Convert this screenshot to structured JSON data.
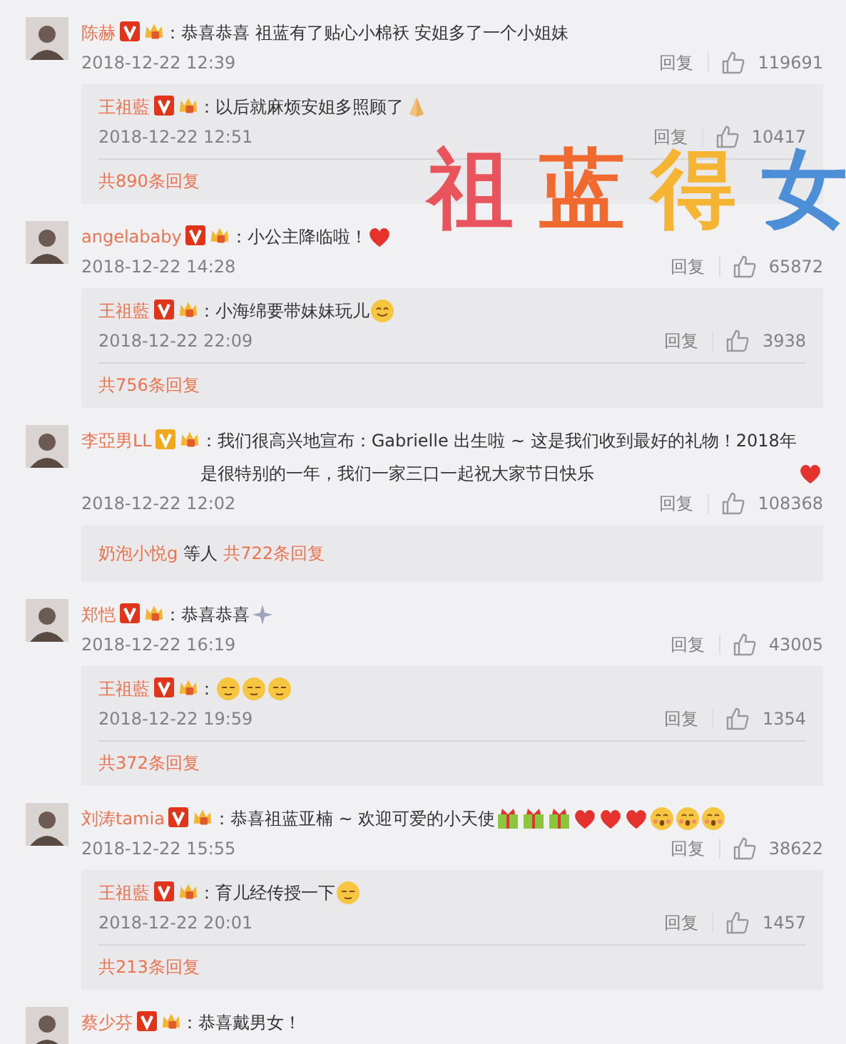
{
  "overlay_title": [
    {
      "text": "祖",
      "color": "#e9545c"
    },
    {
      "text": "蓝",
      "color": "#f06a2f"
    },
    {
      "text": "得",
      "color": "#f6b433"
    },
    {
      "text": "女",
      "color": "#4d8fd6"
    }
  ],
  "comments": [
    {
      "user": "陈赫",
      "verified": {
        "color": "#e0341b"
      },
      "text": "：恭喜恭喜 祖蓝有了贴心小棉袄 安姐多了一个小姐妹",
      "date": "2018-12-22 12:39",
      "reply_label": "回复",
      "likes": "119691",
      "replies": {
        "kind": "thread",
        "user": "王祖藍",
        "verified": {
          "color": "#e0341b"
        },
        "text": "：以后就麻烦安姐多照顾了",
        "emojis": [
          {
            "kind": "hands"
          }
        ],
        "date": "2018-12-22 12:51",
        "reply_label": "回复",
        "likes": "10417",
        "more": "共890条回复"
      }
    },
    {
      "user": "angelababy",
      "verified": {
        "color": "#e0341b"
      },
      "text": "：小公主降临啦！",
      "emojis": [
        {
          "kind": "heart"
        }
      ],
      "date": "2018-12-22 14:28",
      "reply_label": "回复",
      "likes": "65872",
      "replies": {
        "kind": "thread",
        "user": "王祖藍",
        "verified": {
          "color": "#e0341b"
        },
        "text": "：小海绵要带妹妹玩儿",
        "emojis": [
          {
            "kind": "smile"
          }
        ],
        "date": "2018-12-22 22:09",
        "reply_label": "回复",
        "likes": "3938",
        "more": "共756条回复"
      }
    },
    {
      "user": "李亞男LL",
      "verified": {
        "color": "#f0a81c"
      },
      "text": "：我们很高兴地宣布：Gabrielle 出生啦 ~ 这是我们收到最好的礼物！2018年是很特别的一年，我们一家三口一起祝大家节日快乐",
      "emojis": [
        {
          "kind": "heart"
        }
      ],
      "date": "2018-12-22 12:02",
      "reply_label": "回复",
      "likes": "108368",
      "replies": {
        "kind": "summary",
        "user": "奶泡小悦g",
        "mid": "等人",
        "more": "共722条回复"
      }
    },
    {
      "user": "郑恺",
      "verified": {
        "color": "#e0341b"
      },
      "text": "：恭喜恭喜",
      "emojis": [
        {
          "kind": "sparkle"
        }
      ],
      "date": "2018-12-22 16:19",
      "reply_label": "回复",
      "likes": "43005",
      "replies": {
        "kind": "thread",
        "user": "王祖藍",
        "verified": {
          "color": "#e0341b"
        },
        "text": "：",
        "emojis": [
          {
            "kind": "smug"
          },
          {
            "kind": "smug"
          },
          {
            "kind": "smug"
          }
        ],
        "date": "2018-12-22 19:59",
        "reply_label": "回复",
        "likes": "1354",
        "more": "共372条回复"
      }
    },
    {
      "user": "刘涛tamia",
      "verified": {
        "color": "#e0341b"
      },
      "text": "：恭喜祖蓝亚楠 ~ 欢迎可爱的小天使",
      "emojis": [
        {
          "kind": "gift"
        },
        {
          "kind": "gift"
        },
        {
          "kind": "gift"
        },
        {
          "kind": "heart"
        },
        {
          "kind": "heart"
        },
        {
          "kind": "heart"
        },
        {
          "kind": "blush"
        },
        {
          "kind": "blush"
        },
        {
          "kind": "blush"
        }
      ],
      "date": "2018-12-22 15:55",
      "reply_label": "回复",
      "likes": "38622",
      "replies": {
        "kind": "thread",
        "user": "王祖藍",
        "verified": {
          "color": "#e0341b"
        },
        "text": "：育儿经传授一下",
        "emojis": [
          {
            "kind": "smug"
          }
        ],
        "date": "2018-12-22 20:01",
        "reply_label": "回复",
        "likes": "1457",
        "more": "共213条回复"
      }
    },
    {
      "user": "蔡少芬",
      "verified": {
        "color": "#e0341b"
      },
      "text": "：恭喜戴男女！"
    }
  ]
}
